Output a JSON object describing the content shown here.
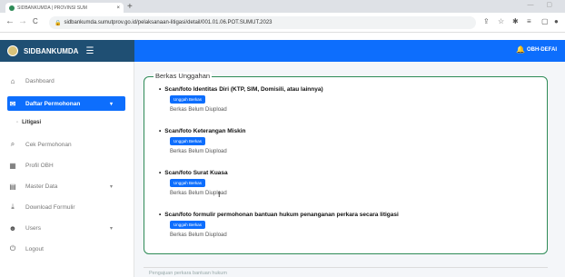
{
  "browser": {
    "tab_title": "SIDBANKUMDA | PROVINSI SUM",
    "tab_close": "×",
    "new_tab": "+",
    "url": "sidbankumda.sumutprov.go.id/pelaksanaan-litigasi/detail/001.01.06.POT.SUMUT.2023",
    "back": "←",
    "forward": "→",
    "reload": "C"
  },
  "app": {
    "brand": "SIDBANKUMDA",
    "user_label": "OBH-DEFAI"
  },
  "sidebar": {
    "items": [
      {
        "label": "Dashboard",
        "icon": "home-icon",
        "glyph": "⌂"
      },
      {
        "label": "Daftar Permohonan",
        "icon": "mail-icon",
        "glyph": "✉",
        "active": true
      },
      {
        "label": "Cek Permohonan",
        "icon": "search-icon",
        "glyph": "⌕"
      },
      {
        "label": "Profil OBH",
        "icon": "grid-icon",
        "glyph": "▦"
      },
      {
        "label": "Master Data",
        "icon": "file-icon",
        "glyph": "▤"
      },
      {
        "label": "Download Formulir",
        "icon": "download-icon",
        "glyph": "⤓"
      },
      {
        "label": "Users",
        "icon": "user-icon",
        "glyph": "☻"
      },
      {
        "label": "Logout",
        "icon": "power-icon",
        "glyph": "⏻"
      }
    ],
    "sub_item": "Litigasi"
  },
  "main": {
    "section_title": "Berkas Unggahan",
    "upload_button": "Unggah Berkas",
    "uploads": [
      {
        "label": "Scan/foto Identitas Diri (KTP, SIM, Domisili, atau lainnya)",
        "status": "Berkas Belum Diupload"
      },
      {
        "label": "Scan/foto Keterangan Miskin",
        "status": "Berkas Belum Diupload"
      },
      {
        "label": "Scan/foto Surat Kuasa",
        "status": "Berkas Belum Diupload"
      },
      {
        "label": "Scan/foto formulir permohonan bantuan hukum penanganan perkara secara litigasi",
        "status": "Berkas Belum Diupload"
      }
    ],
    "footer_text": "Pengajuan perkara bantuan hukum"
  },
  "colors": {
    "accent": "#0d6efd",
    "brand_bg": "#1f4f73",
    "card_border": "#2e8b57"
  }
}
